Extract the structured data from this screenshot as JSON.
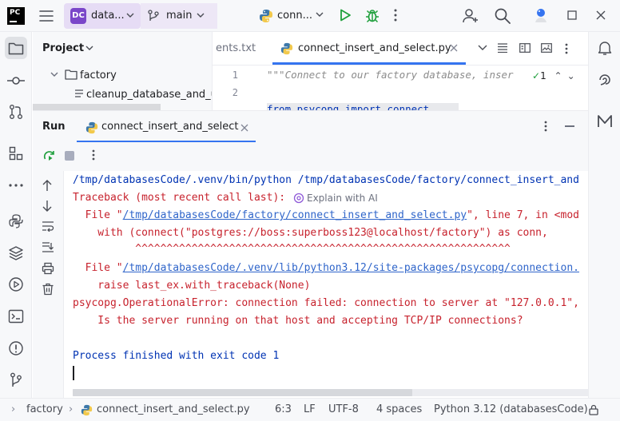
{
  "titlebar": {
    "logo_text": "PC",
    "project_badge": "DC",
    "project_name": "data...",
    "branch": "main",
    "run_config": "conn...",
    "colors": {
      "project_widget": "#e6dcf5",
      "badge": "#7a46c9",
      "run": "#1f9f3c"
    }
  },
  "project_panel": {
    "title": "Project",
    "tree": [
      {
        "type": "folder",
        "label": "factory"
      },
      {
        "type": "file",
        "label": "cleanup_database_and_us"
      }
    ]
  },
  "editor": {
    "tabs": [
      {
        "label": "ents.txt",
        "active": false
      },
      {
        "label": "connect_insert_and_select.py",
        "active": true
      }
    ],
    "line_numbers": [
      "1",
      "2"
    ],
    "lines": [
      "\"\"\"Connect to our factory database, inser",
      "from psycopg import connect"
    ],
    "inspection": "1"
  },
  "run": {
    "title": "Run",
    "tab_label": "connect_insert_and_select",
    "explain_ai": "Explain with AI",
    "console": [
      {
        "kind": "cmd",
        "text": "/tmp/databasesCode/.venv/bin/python /tmp/databasesCode/factory/connect_insert_and"
      },
      {
        "kind": "err",
        "text": "Traceback (most recent call last):"
      },
      {
        "kind": "file",
        "pre": "  File \"",
        "link": "/tmp/databasesCode/factory/connect_insert_and_select.py",
        "post": "\", line 7, in <mod"
      },
      {
        "kind": "err",
        "text": "    with (connect(\"postgres://boss:superboss123@localhost/factory\") as conn,"
      },
      {
        "kind": "err",
        "text": "          ^^^^^^^^^^^^^^^^^^^^^^^^^^^^^^^^^^^^^^^^^^^^^^^^^^^^^^^^^^^^"
      },
      {
        "kind": "file",
        "pre": "  File \"",
        "link": "/tmp/databasesCode/.venv/lib/python3.12/site-packages/psycopg/connection.",
        "post": ""
      },
      {
        "kind": "err",
        "text": "    raise last_ex.with_traceback(None)"
      },
      {
        "kind": "err",
        "text": "psycopg.OperationalError: connection failed: connection to server at \"127.0.0.1\","
      },
      {
        "kind": "err",
        "text": "    Is the server running on that host and accepting TCP/IP connections?"
      },
      {
        "kind": "blank",
        "text": ""
      },
      {
        "kind": "cmd",
        "text": "Process finished with exit code 1"
      }
    ]
  },
  "statusbar": {
    "breadcrumb_folder": "factory",
    "breadcrumb_file": "connect_insert_and_select.py",
    "position": "6:3",
    "line_sep": "LF",
    "encoding": "UTF-8",
    "indent": "4 spaces",
    "interpreter": "Python 3.12 (databasesCode)"
  }
}
